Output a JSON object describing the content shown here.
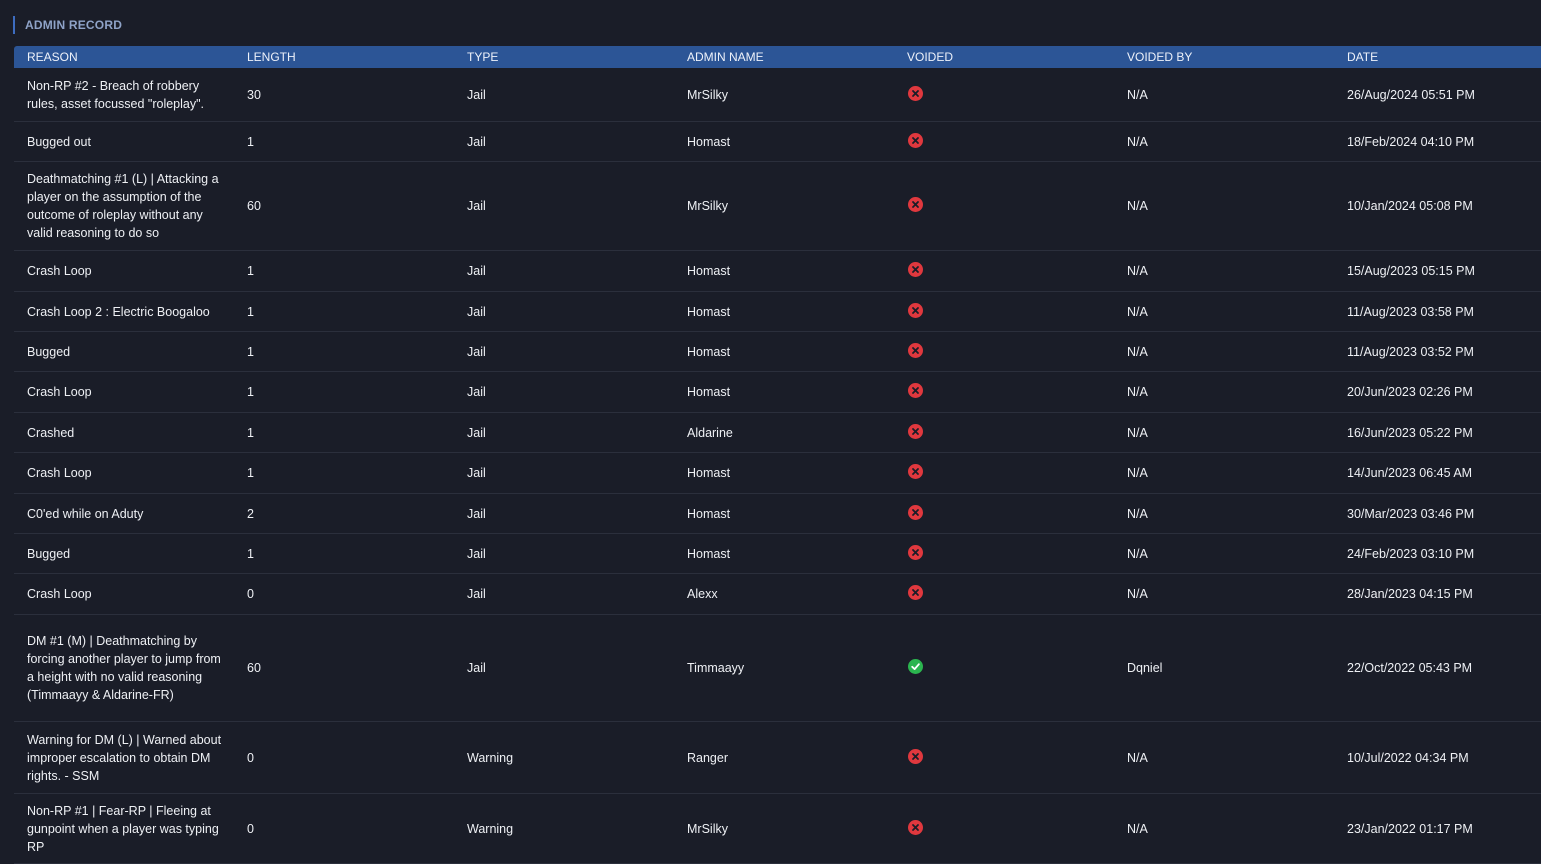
{
  "section": {
    "title": "ADMIN RECORD"
  },
  "columns": [
    "REASON",
    "LENGTH",
    "TYPE",
    "ADMIN NAME",
    "VOIDED",
    "VOIDED BY",
    "DATE"
  ],
  "colors": {
    "accent": "#2c5596",
    "voided_false": "#e0383e",
    "voided_true": "#2bb54f"
  },
  "rows": [
    {
      "reason": "Non-RP #2 - Breach of robbery rules, asset focussed \"roleplay\".",
      "length": "30",
      "type": "Jail",
      "admin": "MrSilky",
      "voided": false,
      "voided_icon": "x-circle-icon",
      "voided_by": "N/A",
      "date": "26/Aug/2024 05:51 PM"
    },
    {
      "reason": "Bugged out",
      "length": "1",
      "type": "Jail",
      "admin": "Homast",
      "voided": false,
      "voided_icon": "x-circle-icon",
      "voided_by": "N/A",
      "date": "18/Feb/2024 04:10 PM"
    },
    {
      "reason": "Deathmatching #1 (L) | Attacking a player on the assumption of the outcome of roleplay without any valid reasoning to do so",
      "length": "60",
      "type": "Jail",
      "admin": "MrSilky",
      "voided": false,
      "voided_icon": "x-circle-icon",
      "voided_by": "N/A",
      "date": "10/Jan/2024 05:08 PM"
    },
    {
      "reason": "Crash Loop",
      "length": "1",
      "type": "Jail",
      "admin": "Homast",
      "voided": false,
      "voided_icon": "x-circle-icon",
      "voided_by": "N/A",
      "date": "15/Aug/2023 05:15 PM"
    },
    {
      "reason": "Crash Loop 2 : Electric Boogaloo",
      "length": "1",
      "type": "Jail",
      "admin": "Homast",
      "voided": false,
      "voided_icon": "x-circle-icon",
      "voided_by": "N/A",
      "date": "11/Aug/2023 03:58 PM"
    },
    {
      "reason": "Bugged",
      "length": "1",
      "type": "Jail",
      "admin": "Homast",
      "voided": false,
      "voided_icon": "x-circle-icon",
      "voided_by": "N/A",
      "date": "11/Aug/2023 03:52 PM"
    },
    {
      "reason": "Crash Loop",
      "length": "1",
      "type": "Jail",
      "admin": "Homast",
      "voided": false,
      "voided_icon": "x-circle-icon",
      "voided_by": "N/A",
      "date": "20/Jun/2023 02:26 PM"
    },
    {
      "reason": "Crashed",
      "length": "1",
      "type": "Jail",
      "admin": "Aldarine",
      "voided": false,
      "voided_icon": "x-circle-icon",
      "voided_by": "N/A",
      "date": "16/Jun/2023 05:22 PM"
    },
    {
      "reason": "Crash Loop",
      "length": "1",
      "type": "Jail",
      "admin": "Homast",
      "voided": false,
      "voided_icon": "x-circle-icon",
      "voided_by": "N/A",
      "date": "14/Jun/2023 06:45 AM"
    },
    {
      "reason": "C0'ed while on Aduty",
      "length": "2",
      "type": "Jail",
      "admin": "Homast",
      "voided": false,
      "voided_icon": "x-circle-icon",
      "voided_by": "N/A",
      "date": "30/Mar/2023 03:46 PM"
    },
    {
      "reason": "Bugged",
      "length": "1",
      "type": "Jail",
      "admin": "Homast",
      "voided": false,
      "voided_icon": "x-circle-icon",
      "voided_by": "N/A",
      "date": "24/Feb/2023 03:10 PM"
    },
    {
      "reason": "Crash Loop",
      "length": "0",
      "type": "Jail",
      "admin": "Alexx",
      "voided": false,
      "voided_icon": "x-circle-icon",
      "voided_by": "N/A",
      "date": "28/Jan/2023 04:15 PM"
    },
    {
      "reason": "DM #1 (M) | Deathmatching by forcing another player to jump from a height with no valid reasoning (Timmaayy & Aldarine-FR)",
      "length": "60",
      "type": "Jail",
      "admin": "Timmaayy",
      "voided": true,
      "voided_icon": "check-circle-icon",
      "voided_by": "Dqniel",
      "date": "22/Oct/2022 05:43 PM"
    },
    {
      "reason": "Warning for DM (L) | Warned about improper escalation to obtain DM rights. - SSM",
      "length": "0",
      "type": "Warning",
      "admin": "Ranger",
      "voided": false,
      "voided_icon": "x-circle-icon",
      "voided_by": "N/A",
      "date": "10/Jul/2022 04:34 PM"
    },
    {
      "reason": "Non-RP #1 | Fear-RP | Fleeing at gunpoint when a player was typing RP",
      "length": "0",
      "type": "Warning",
      "admin": "MrSilky",
      "voided": false,
      "voided_icon": "x-circle-icon",
      "voided_by": "N/A",
      "date": "23/Jan/2022 01:17 PM"
    }
  ]
}
